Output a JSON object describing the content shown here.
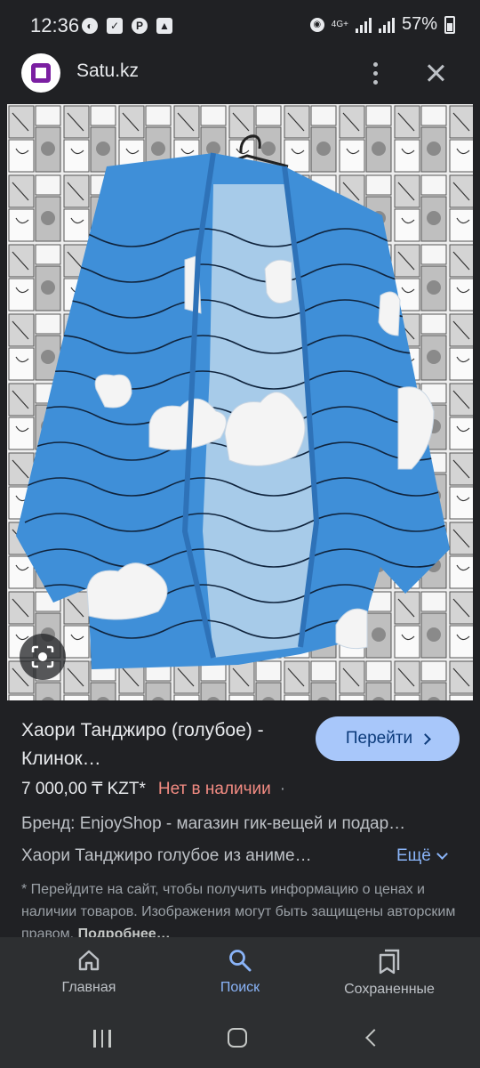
{
  "status_bar": {
    "time": "12:36",
    "network": "4G+",
    "battery": "57%"
  },
  "site": {
    "name": "Satu.kz"
  },
  "product": {
    "title": "Хаори Танджиро (голубое) - Клинок…",
    "go_button": "Перейти",
    "price": "7 000,00 ₸ KZT*",
    "stock": "Нет в наличии",
    "separator": "·",
    "brand": "Бренд: EnjoyShop - магазин гик-вещей и подар…",
    "description": "Хаори Танджиро голубое из аниме…",
    "more_label": "Ещё",
    "disclaimer": "* Перейдите на сайт, чтобы получить информацию о ценах и наличии товаров. Изображения могут быть защищены авторским правом.",
    "details_link": "Подробнее…"
  },
  "bottom_nav": [
    {
      "label": "Главная",
      "icon": "home-icon",
      "active": false
    },
    {
      "label": "Поиск",
      "icon": "search-icon",
      "active": true
    },
    {
      "label": "Сохраненные",
      "icon": "bookmarks-icon",
      "active": false
    }
  ],
  "colors": {
    "background": "#202124",
    "accent": "#8ab4f8",
    "button_bg": "#a8c7fa",
    "stock_red": "#f28b82",
    "garment_blue": "#3f8fd8"
  }
}
